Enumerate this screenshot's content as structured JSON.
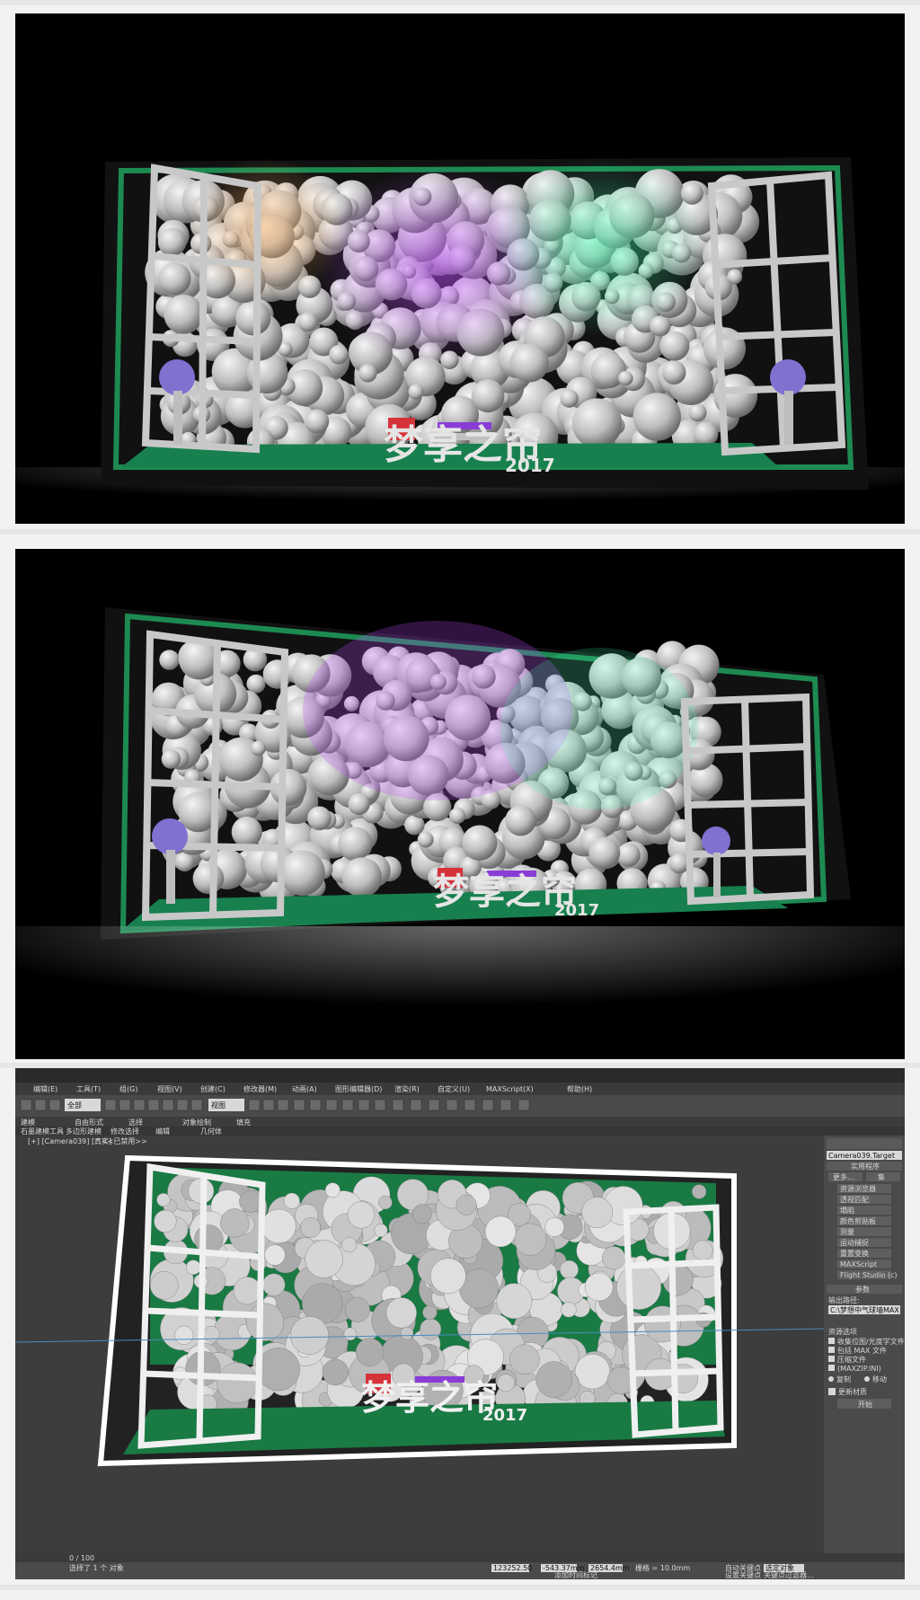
{
  "render": {
    "logo_main": "梦享之帘",
    "logo_year": "2017"
  },
  "max_ui": {
    "menu": [
      "编辑(E)",
      "工具(T)",
      "组(G)",
      "视图(V)",
      "创建(C)",
      "修改器(M)",
      "动画(A)",
      "图形编辑器(D)",
      "渲染(R)",
      "自定义(U)",
      "MAXScript(X)",
      "帮助(H)"
    ],
    "toolbar_select": "全部",
    "toolbar_view": "视图",
    "ribbon_tabs": [
      "建模",
      "自由形式",
      "选择",
      "对象绘制",
      "填充"
    ],
    "ribbon_sub": [
      "石墨建模工具",
      "多边形建模",
      "修改选择",
      "编辑",
      "几何体"
    ],
    "viewport_label": "[+] [Camera039] [真实]",
    "viewport_note": "<<已禁用>>",
    "cmd_object_name": "Camera039.Target",
    "cmd_rollout_utilities": "实用程序",
    "cmd_more_button": "更多...",
    "cmd_sets_button": "集",
    "cmd_items": [
      "资源浏览器",
      "透视匹配",
      "塌陷",
      "颜色剪贴板",
      "测量",
      "运动捕捉",
      "重置变换",
      "MAXScript",
      "Flight Studio (c)"
    ],
    "params_title": "参数",
    "output_path_label": "输出路径:",
    "output_path_value": "C:\\梦想中气球墙MAX",
    "resource_options_label": "资源选项",
    "checkbox_items": [
      "收集位图/光度学文件",
      "包括 MAX 文件",
      "压缩文件",
      "(MAXZIP.INI)"
    ],
    "radio_items": [
      "复制",
      "移动"
    ],
    "update_material": "更新材质",
    "start_button": "开始",
    "frame_counter": "0 / 100",
    "status_selected": "选择了 1 个 对象",
    "coord_x": "123252.50",
    "coord_y": "-543.37mm",
    "coord_z": "2654.4mm",
    "grid_label": "栅格 = 10.0mm",
    "auto_key": "自动关键点",
    "selected_obj": "选定对象",
    "set_key": "设置关键点",
    "key_filters": "关键点过滤器...",
    "add_time_tag": "添加时间标记"
  }
}
